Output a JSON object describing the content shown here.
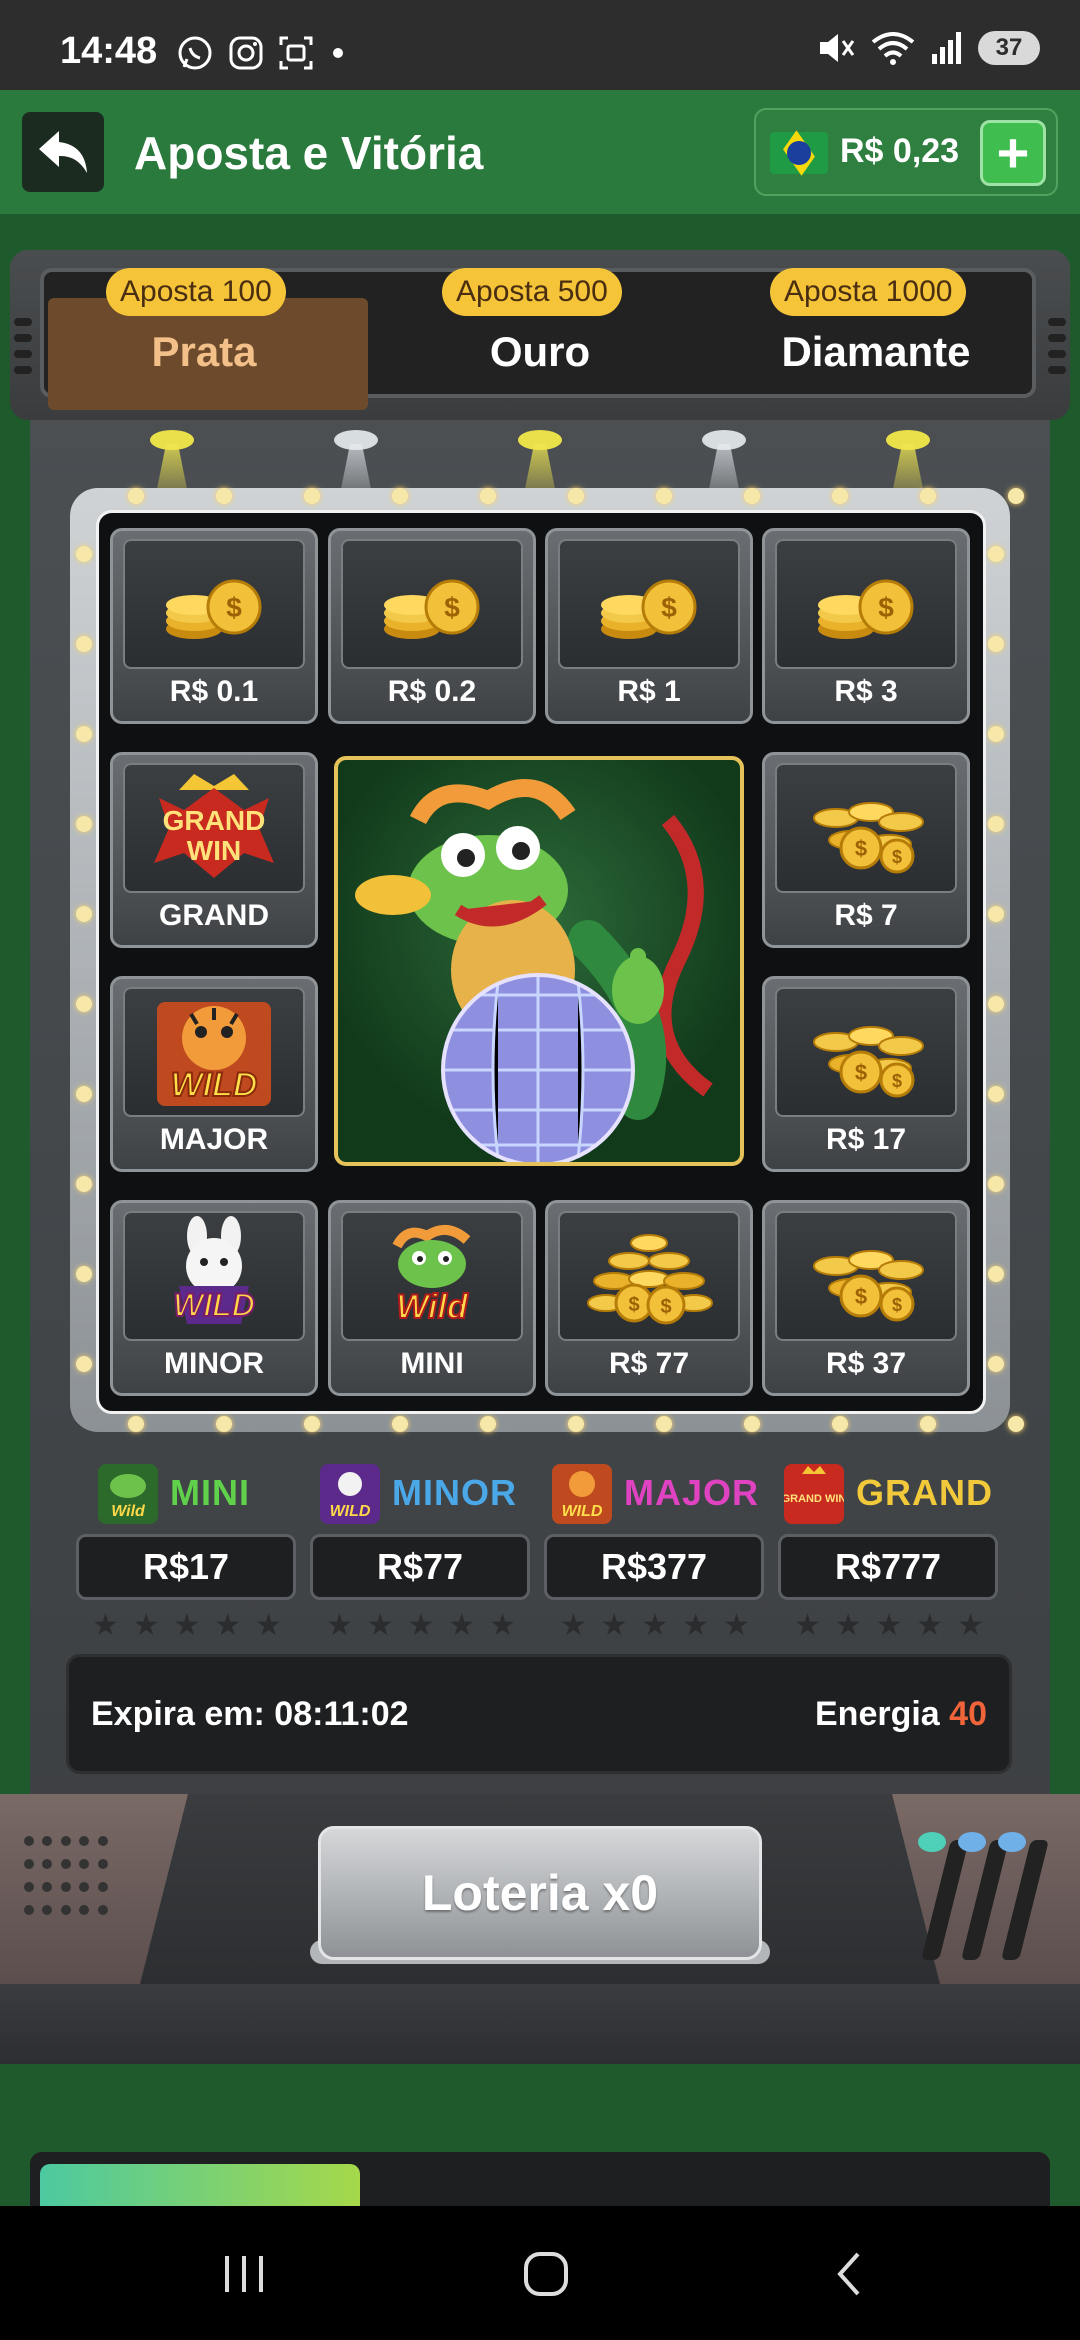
{
  "status_bar": {
    "time": "14:48",
    "left_icons": [
      "whatsapp-icon",
      "instagram-icon",
      "screenshot-icon",
      "dot-icon"
    ],
    "right_icons": [
      "mute-icon",
      "wifi-icon",
      "signal-icon"
    ],
    "battery": "37"
  },
  "header": {
    "title": "Aposta e Vitória",
    "wallet_amount": "R$ 0,23",
    "add_label": "+"
  },
  "tiers": [
    {
      "pill": "Aposta 100",
      "label": "Prata",
      "active": true
    },
    {
      "pill": "Aposta 500",
      "label": "Ouro",
      "active": false
    },
    {
      "pill": "Aposta 1000",
      "label": "Diamante",
      "active": false
    }
  ],
  "prize_board": {
    "cells": [
      {
        "label": "R$ 0.1",
        "icon": "coin-stack-icon"
      },
      {
        "label": "R$ 0.2",
        "icon": "coin-stack-icon"
      },
      {
        "label": "R$ 1",
        "icon": "coin-stack-icon"
      },
      {
        "label": "R$ 3",
        "icon": "coin-stack-icon"
      },
      {
        "label": "GRAND",
        "icon": "grand-win-icon",
        "badge_top": "GRAND",
        "badge_bottom": "WIN"
      },
      {
        "label": "R$ 7",
        "icon": "coin-pile-icon"
      },
      {
        "label": "MAJOR",
        "icon": "tiger-wild-icon",
        "badge": "WILD"
      },
      {
        "label": "R$ 17",
        "icon": "coin-pile-icon"
      },
      {
        "label": "MINOR",
        "icon": "rabbit-wild-icon",
        "badge": "WILD"
      },
      {
        "label": "MINI",
        "icon": "dragon-wild-icon",
        "badge": "Wild"
      },
      {
        "label": "R$ 77",
        "icon": "coin-heap-icon"
      },
      {
        "label": "R$ 37",
        "icon": "coin-pile-icon"
      }
    ],
    "center_icon": "dragon-disco-ball-icon"
  },
  "jackpots": [
    {
      "name": "MINI",
      "value": "R$17",
      "color": "#5fd14a",
      "thumb_badge": "Wild",
      "stars": 5
    },
    {
      "name": "MINOR",
      "value": "R$77",
      "color": "#4aa8e8",
      "thumb_badge": "WILD",
      "stars": 5
    },
    {
      "name": "MAJOR",
      "value": "R$377",
      "color": "#e043c2",
      "thumb_badge": "WILD",
      "stars": 5
    },
    {
      "name": "GRAND",
      "value": "R$777",
      "color": "#f1c93a",
      "thumb_badge": "GRAND WIN",
      "stars": 5
    }
  ],
  "info": {
    "expires": "Expira em: 08:11:02",
    "energy_label": "Energia",
    "energy_value": "40"
  },
  "lottery_button": "Loteria x0",
  "progress": {
    "fraction": 0.32
  },
  "nav": [
    "recents-icon",
    "home-icon",
    "back-icon"
  ],
  "colors": {
    "header_green": "#2a7a3d",
    "pill_yellow": "#f5c438",
    "energy_orange": "#f0643a"
  }
}
